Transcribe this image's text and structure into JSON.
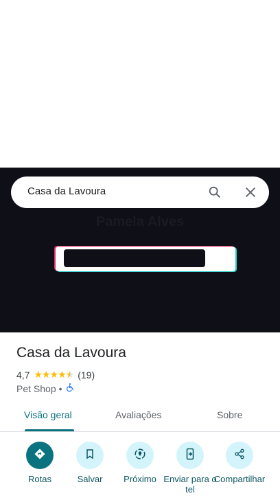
{
  "search": {
    "value": "Casa da Lavoura"
  },
  "photo": {
    "overlay_text": "Pamela Alves"
  },
  "place": {
    "name": "Casa da Lavoura",
    "rating": "4,7",
    "stars": 4.7,
    "reviews": "(19)",
    "category": "Pet Shop",
    "separator": "•"
  },
  "tabs": [
    {
      "label": "Visão geral"
    },
    {
      "label": "Avaliações"
    },
    {
      "label": "Sobre"
    }
  ],
  "actions": [
    {
      "label": "Rotas",
      "icon": "directions-icon"
    },
    {
      "label": "Salvar",
      "icon": "bookmark-icon"
    },
    {
      "label": "Próximo",
      "icon": "nearby-icon"
    },
    {
      "label": "Enviar para o tel",
      "icon": "send-to-phone-icon"
    },
    {
      "label": "Compartilhar",
      "icon": "share-icon"
    }
  ],
  "colors": {
    "accent": "#0b7380",
    "action_bg": "#d3f4fb",
    "star": "#fbbc04"
  }
}
